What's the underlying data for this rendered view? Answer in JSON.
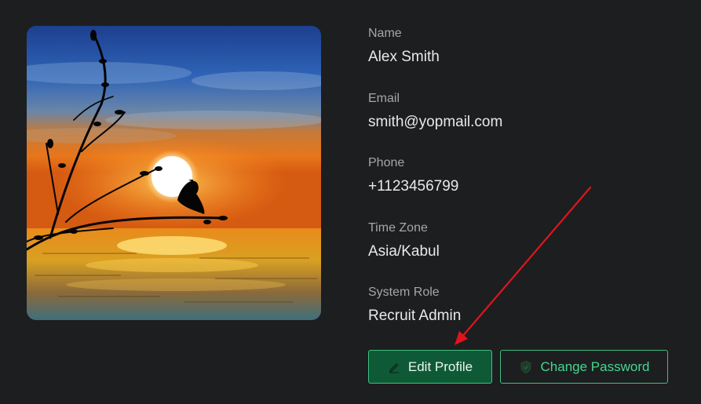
{
  "profile": {
    "name_label": "Name",
    "name_value": "Alex Smith",
    "email_label": "Email",
    "email_value": "smith@yopmail.com",
    "phone_label": "Phone",
    "phone_value": "+1123456799",
    "timezone_label": "Time Zone",
    "timezone_value": "Asia/Kabul",
    "role_label": "System Role",
    "role_value": "Recruit Admin"
  },
  "actions": {
    "edit_label": "Edit Profile",
    "edit_icon": "pencil-icon",
    "change_password_label": "Change Password",
    "change_password_icon": "shield-check-icon"
  },
  "colors": {
    "background": "#1d1e20",
    "accent_green": "#45d690",
    "edit_button_bg": "#0f5a36",
    "annotation_arrow": "#e0151c"
  },
  "avatar": {
    "icon": "sunset-bird-image"
  }
}
